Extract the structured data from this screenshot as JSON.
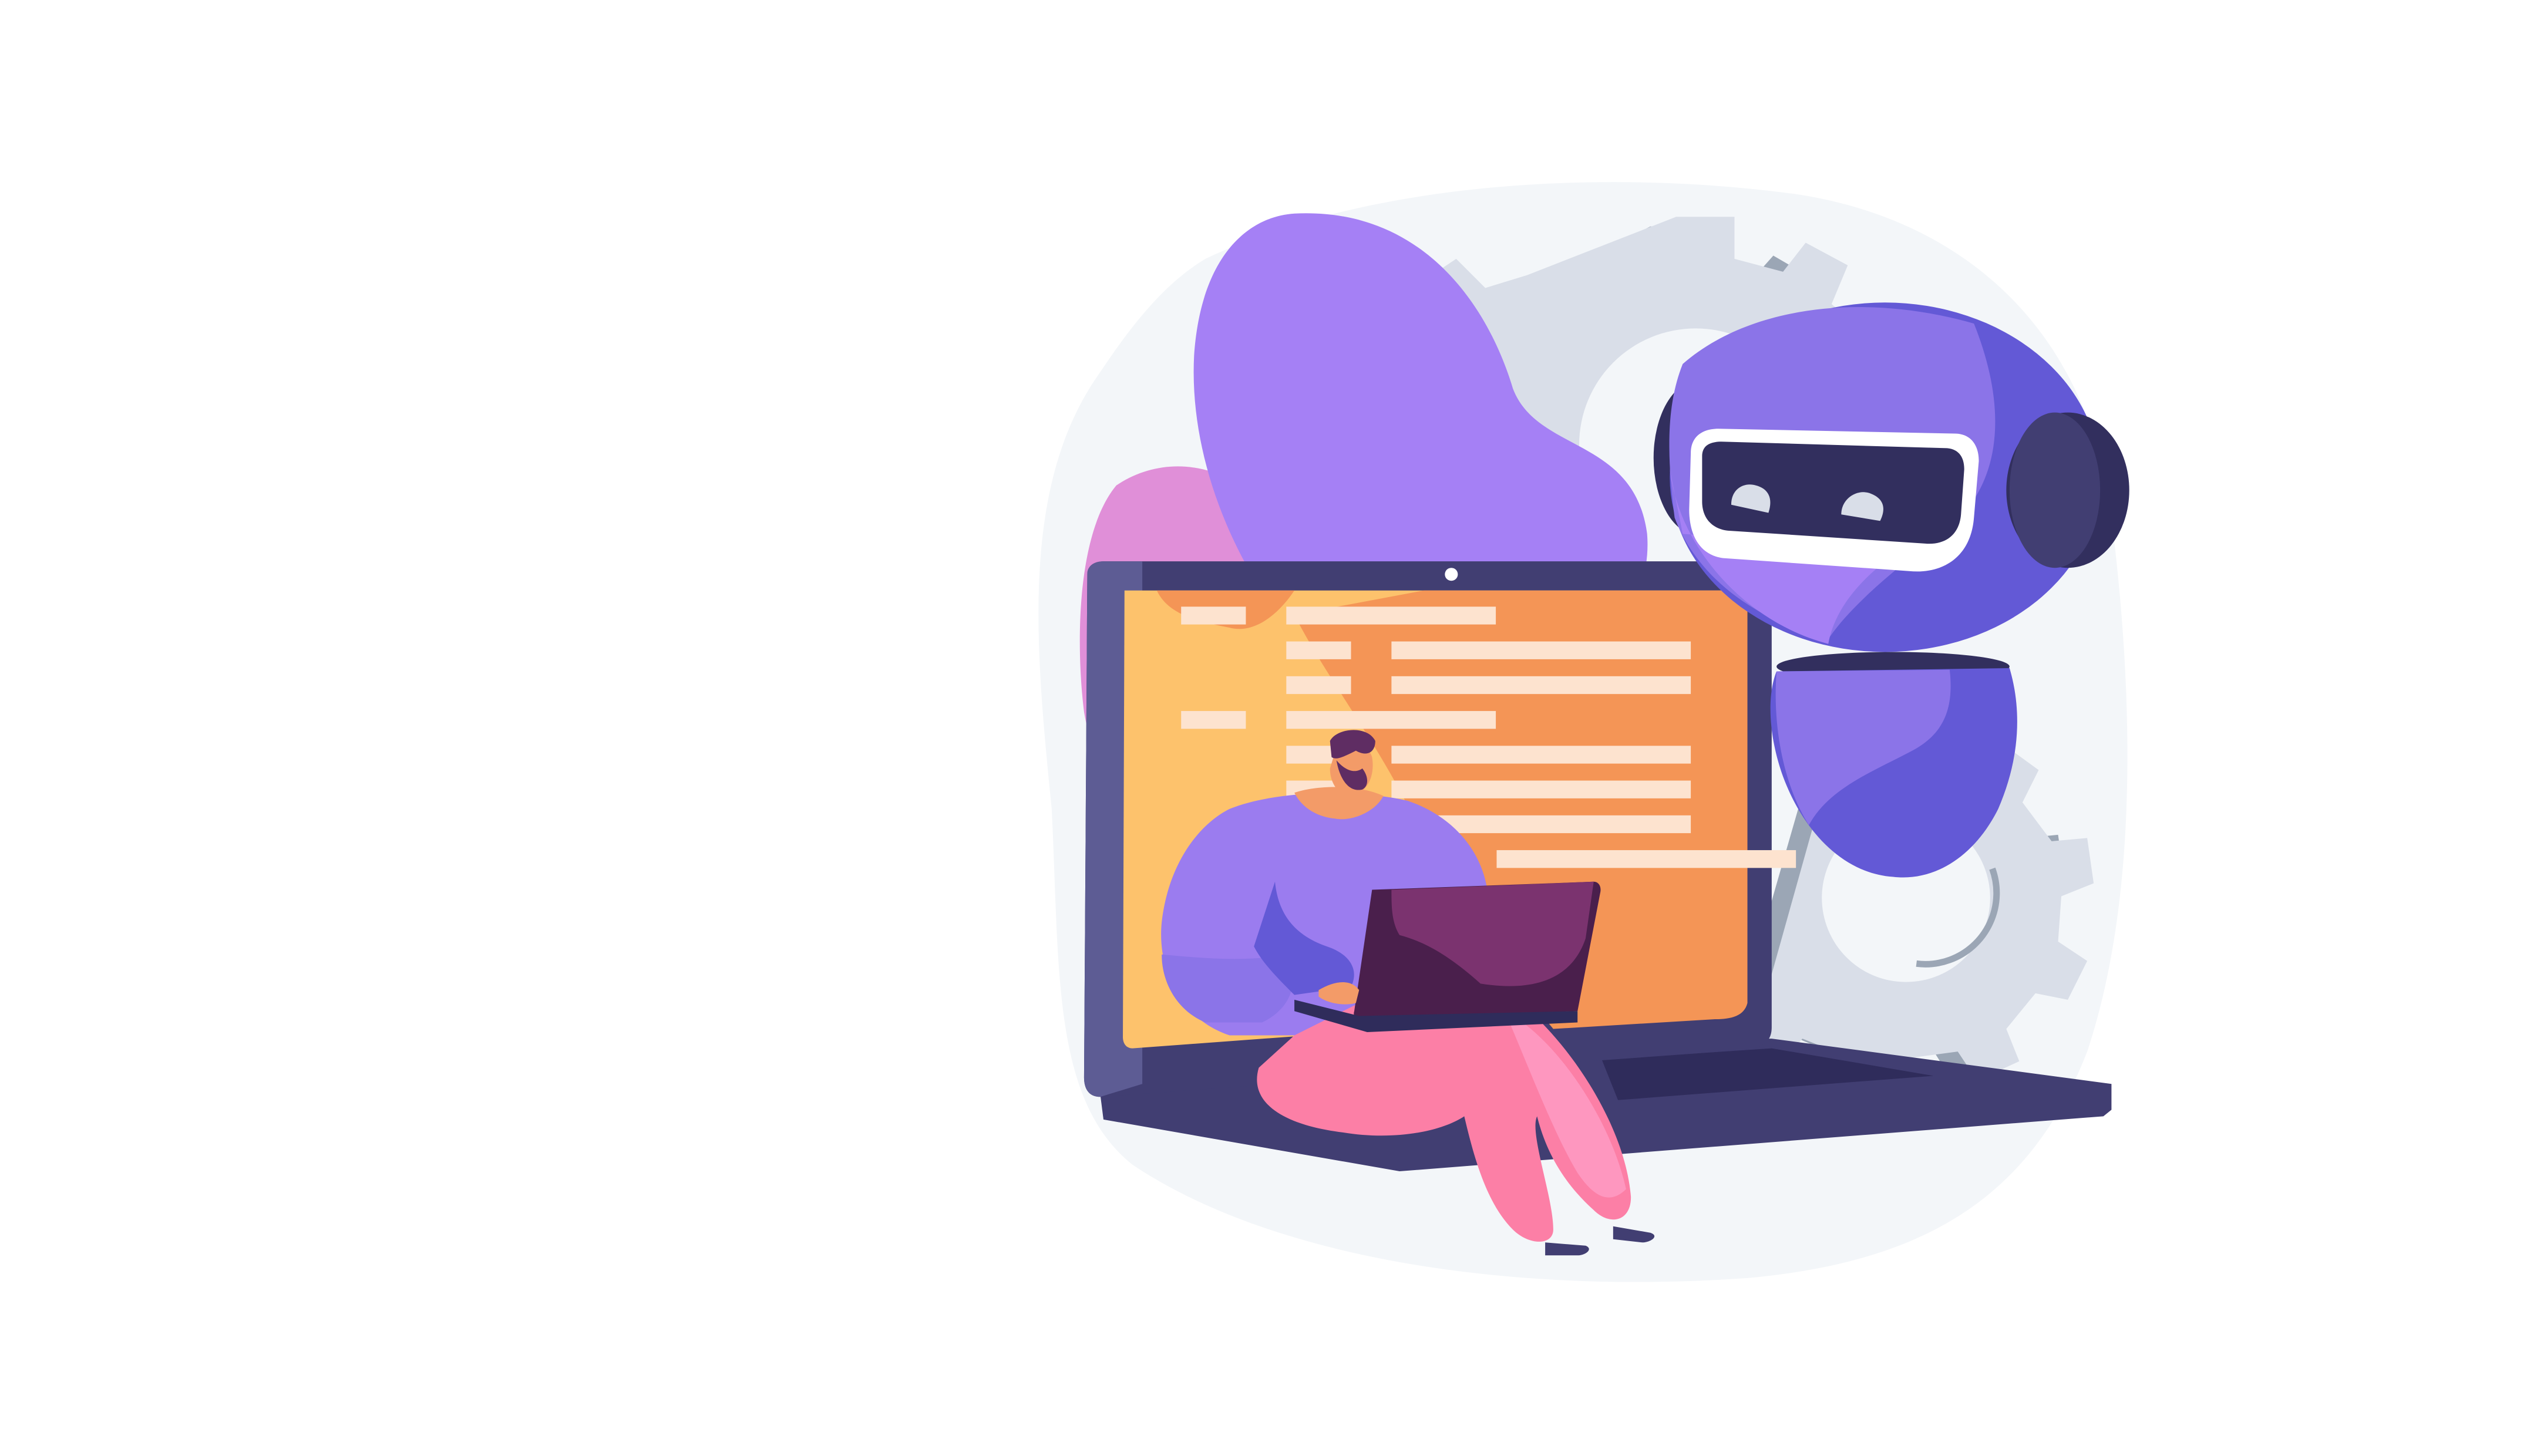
{
  "scene": {
    "subject": "illustration",
    "elements": [
      "background-blob",
      "gear-icon",
      "laptop-icon",
      "code-lines",
      "robot-icon",
      "person-with-laptop"
    ]
  },
  "colors": {
    "background": "#ffffff",
    "blob": "#f3f6f9",
    "purple": "#a580f5",
    "pink_blob": "#e08fd8",
    "gear": "#d9dee8",
    "gear_shadow": "#9ba6b5",
    "laptop": "#413e72",
    "laptop_dark": "#2f2c5b",
    "screen_left": "#fdc26c",
    "screen_right": "#f49556",
    "code_line": "#fde3cf",
    "robot_light": "#8b74e8",
    "robot_dark": "#6359d6",
    "robot_visor": "#322f5e",
    "person_shirt": "#9b7cef",
    "person_pants": "#fc7fa6",
    "person_skin": "#f39b68",
    "person_hair": "#5f2d63",
    "small_laptop": "#4a1f4c"
  },
  "code_rows": [
    {
      "indent": 0,
      "length": 0.7
    },
    {
      "indent": 1,
      "length": 1.0
    },
    {
      "indent": 1,
      "length": 1.0
    },
    {
      "indent": 0,
      "length": 0.7
    },
    {
      "indent": 1,
      "length": 1.0
    },
    {
      "indent": 1,
      "length": 1.0
    },
    {
      "indent": 1,
      "length": 1.0
    },
    {
      "indent": 2,
      "length": 1.0
    }
  ]
}
